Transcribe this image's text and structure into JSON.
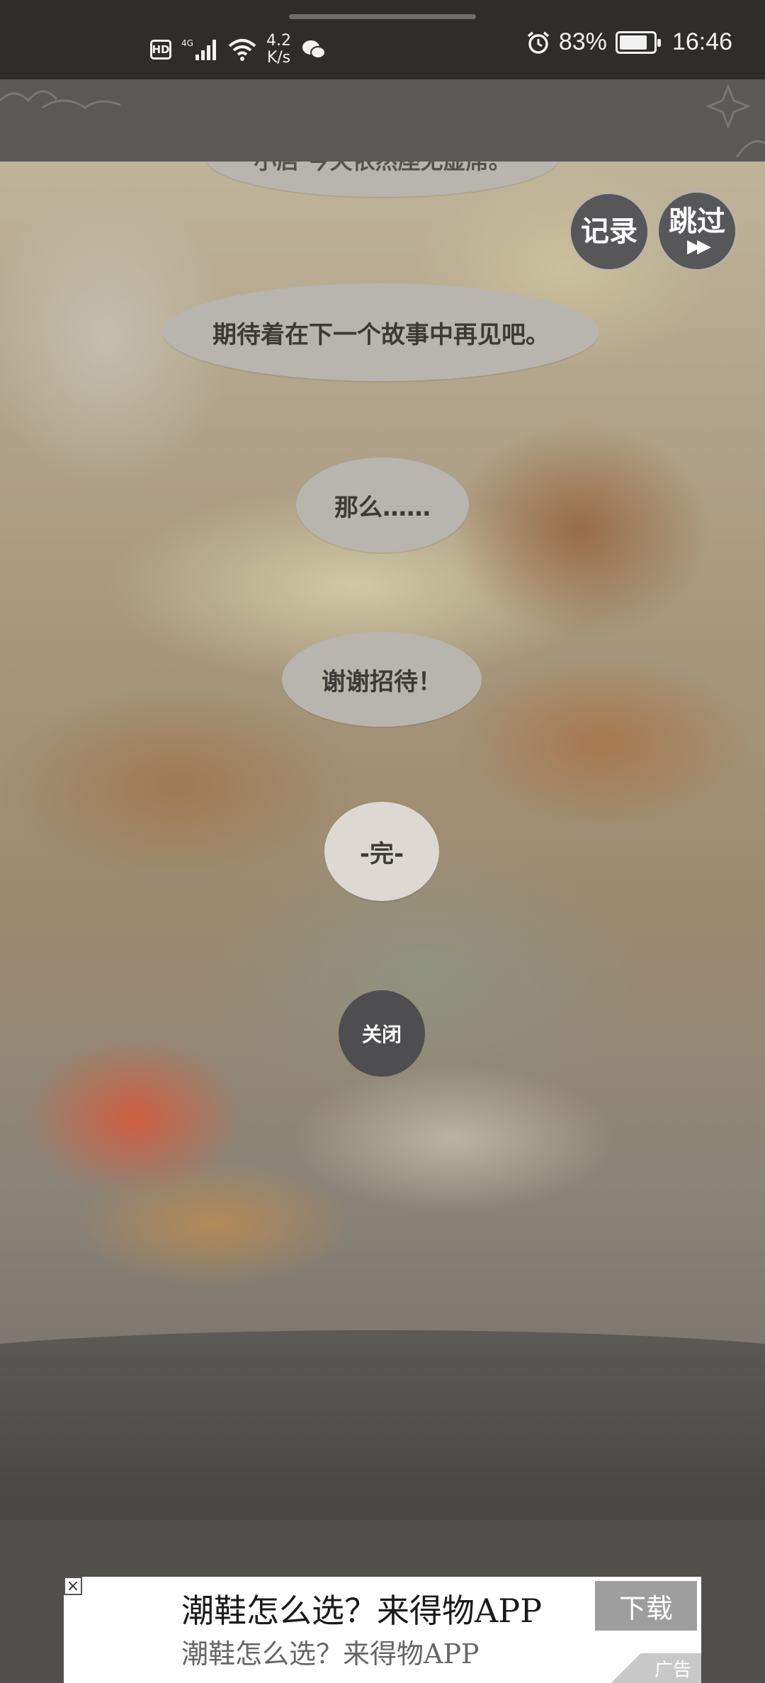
{
  "status_bar": {
    "hd_label": "HD",
    "network_type": "4G",
    "net_speed_value": "4.2",
    "net_speed_unit": "K/s",
    "battery_percent": "83%",
    "battery_level": 0.83,
    "time": "16:46",
    "icons": [
      "hd-icon",
      "signal-icon",
      "wifi-icon",
      "wechat-icon",
      "alarm-icon",
      "battery-icon"
    ]
  },
  "story": {
    "partial_top_line": "小店 今天依然座无虚席。",
    "bubbles": [
      "期待着在下一个故事中再见吧。",
      "那么……",
      "谢谢招待！",
      "-完-"
    ]
  },
  "controls": {
    "log_label": "记录",
    "skip_label": "跳过",
    "skip_arrows": "▶▶",
    "close_label": "关闭"
  },
  "ad": {
    "close_icon": "×",
    "title": "潮鞋怎么选？来得物APP",
    "subtitle": "潮鞋怎么选？来得物APP",
    "download_label": "下载",
    "ad_tag": "广告"
  }
}
